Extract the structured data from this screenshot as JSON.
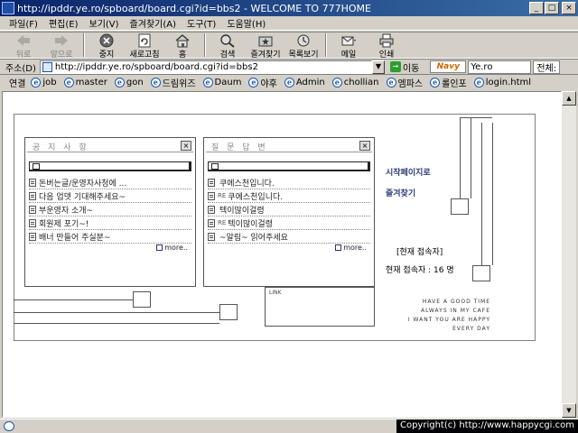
{
  "window": {
    "title": "http://ipddr.ye.ro/spboard/board.cgi?id=bbs2 - WELCOME TO 777HOME",
    "minimize": "_",
    "maximize": "□",
    "close": "×"
  },
  "menu": [
    "파일(F)",
    "편집(E)",
    "보기(V)",
    "즐겨찾기(A)",
    "도구(T)",
    "도움말(H)"
  ],
  "toolbar": {
    "back": "뒤로",
    "forward": "앞으로",
    "stop": "중지",
    "refresh": "새로고침",
    "home": "홈",
    "search": "검색",
    "favorites": "즐겨찾기",
    "history": "목록보기",
    "mail": "메일",
    "print": "인쇄"
  },
  "address": {
    "label": "주소(D)",
    "url": "http://ipddr.ye.ro/spboard/board.cgi?id=bbs2",
    "go": "이동",
    "navy_logo": "Navy",
    "navy_value": "Ye.ro",
    "navy_all": "전체:"
  },
  "links": {
    "label": "연결",
    "items": [
      "job",
      "master",
      "gon",
      "드림위즈",
      "Daum",
      "야후",
      "Admin",
      "chollian",
      "엠파스",
      "롤인포",
      "login.html"
    ]
  },
  "panels": {
    "notice": {
      "title": "공 지 사 항",
      "close": "×",
      "rows": [
        "돈버는글/운영자사청에 ...",
        "다음 업뎃 기대해주세요~",
        "부운영자 소개~",
        "회원제 포기~!",
        "배너 만들어 주실분~"
      ],
      "more": "more.."
    },
    "qna": {
      "title": "질 문 답 변",
      "close": "×",
      "rows": [
        {
          "prefix": "",
          "text": "쿠에스천입니다."
        },
        {
          "prefix": "RE",
          "text": "쿠에스천입니다."
        },
        {
          "prefix": "",
          "text": "텍이많이걸령"
        },
        {
          "prefix": "RE",
          "text": "텍이많이걸령"
        },
        {
          "prefix": "",
          "text": "~알림~ 읽어주세요"
        }
      ],
      "more": "more.."
    }
  },
  "side": {
    "start_page": "시작페이지로",
    "add_favorite": "즐겨찾기",
    "visitors_heading": "[현재 접속자]",
    "visitors_count": "현재 접속자 : 16 명"
  },
  "link_box": {
    "label": "LINK"
  },
  "motto": [
    "HAVE A GOOD TIME",
    "ALWAYS IN MY CAFE",
    "I WANT YOU ARE HAPPY",
    "EVERY DAY"
  ],
  "status": {
    "copyright": "Copyright(c) http://www.happycgi.com"
  }
}
